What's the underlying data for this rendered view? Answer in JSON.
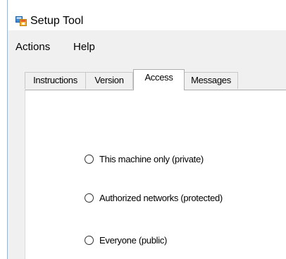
{
  "window": {
    "title": "Setup Tool",
    "icon": "app-window-icon"
  },
  "menu": {
    "items": [
      {
        "label": "Actions"
      },
      {
        "label": "Help"
      }
    ]
  },
  "tabs": {
    "items": [
      {
        "label": "Instructions",
        "selected": false
      },
      {
        "label": "Version",
        "selected": false
      },
      {
        "label": "Access",
        "selected": true
      },
      {
        "label": "Messages",
        "selected": false
      }
    ]
  },
  "access": {
    "options": [
      {
        "label": "This machine only (private)",
        "checked": false
      },
      {
        "label": "Authorized networks (protected)",
        "checked": false
      },
      {
        "label": "Everyone (public)",
        "checked": false
      }
    ]
  },
  "colors": {
    "window_background": "#f0f0f0",
    "panel_background": "#ffffff",
    "border": "#adadad"
  }
}
